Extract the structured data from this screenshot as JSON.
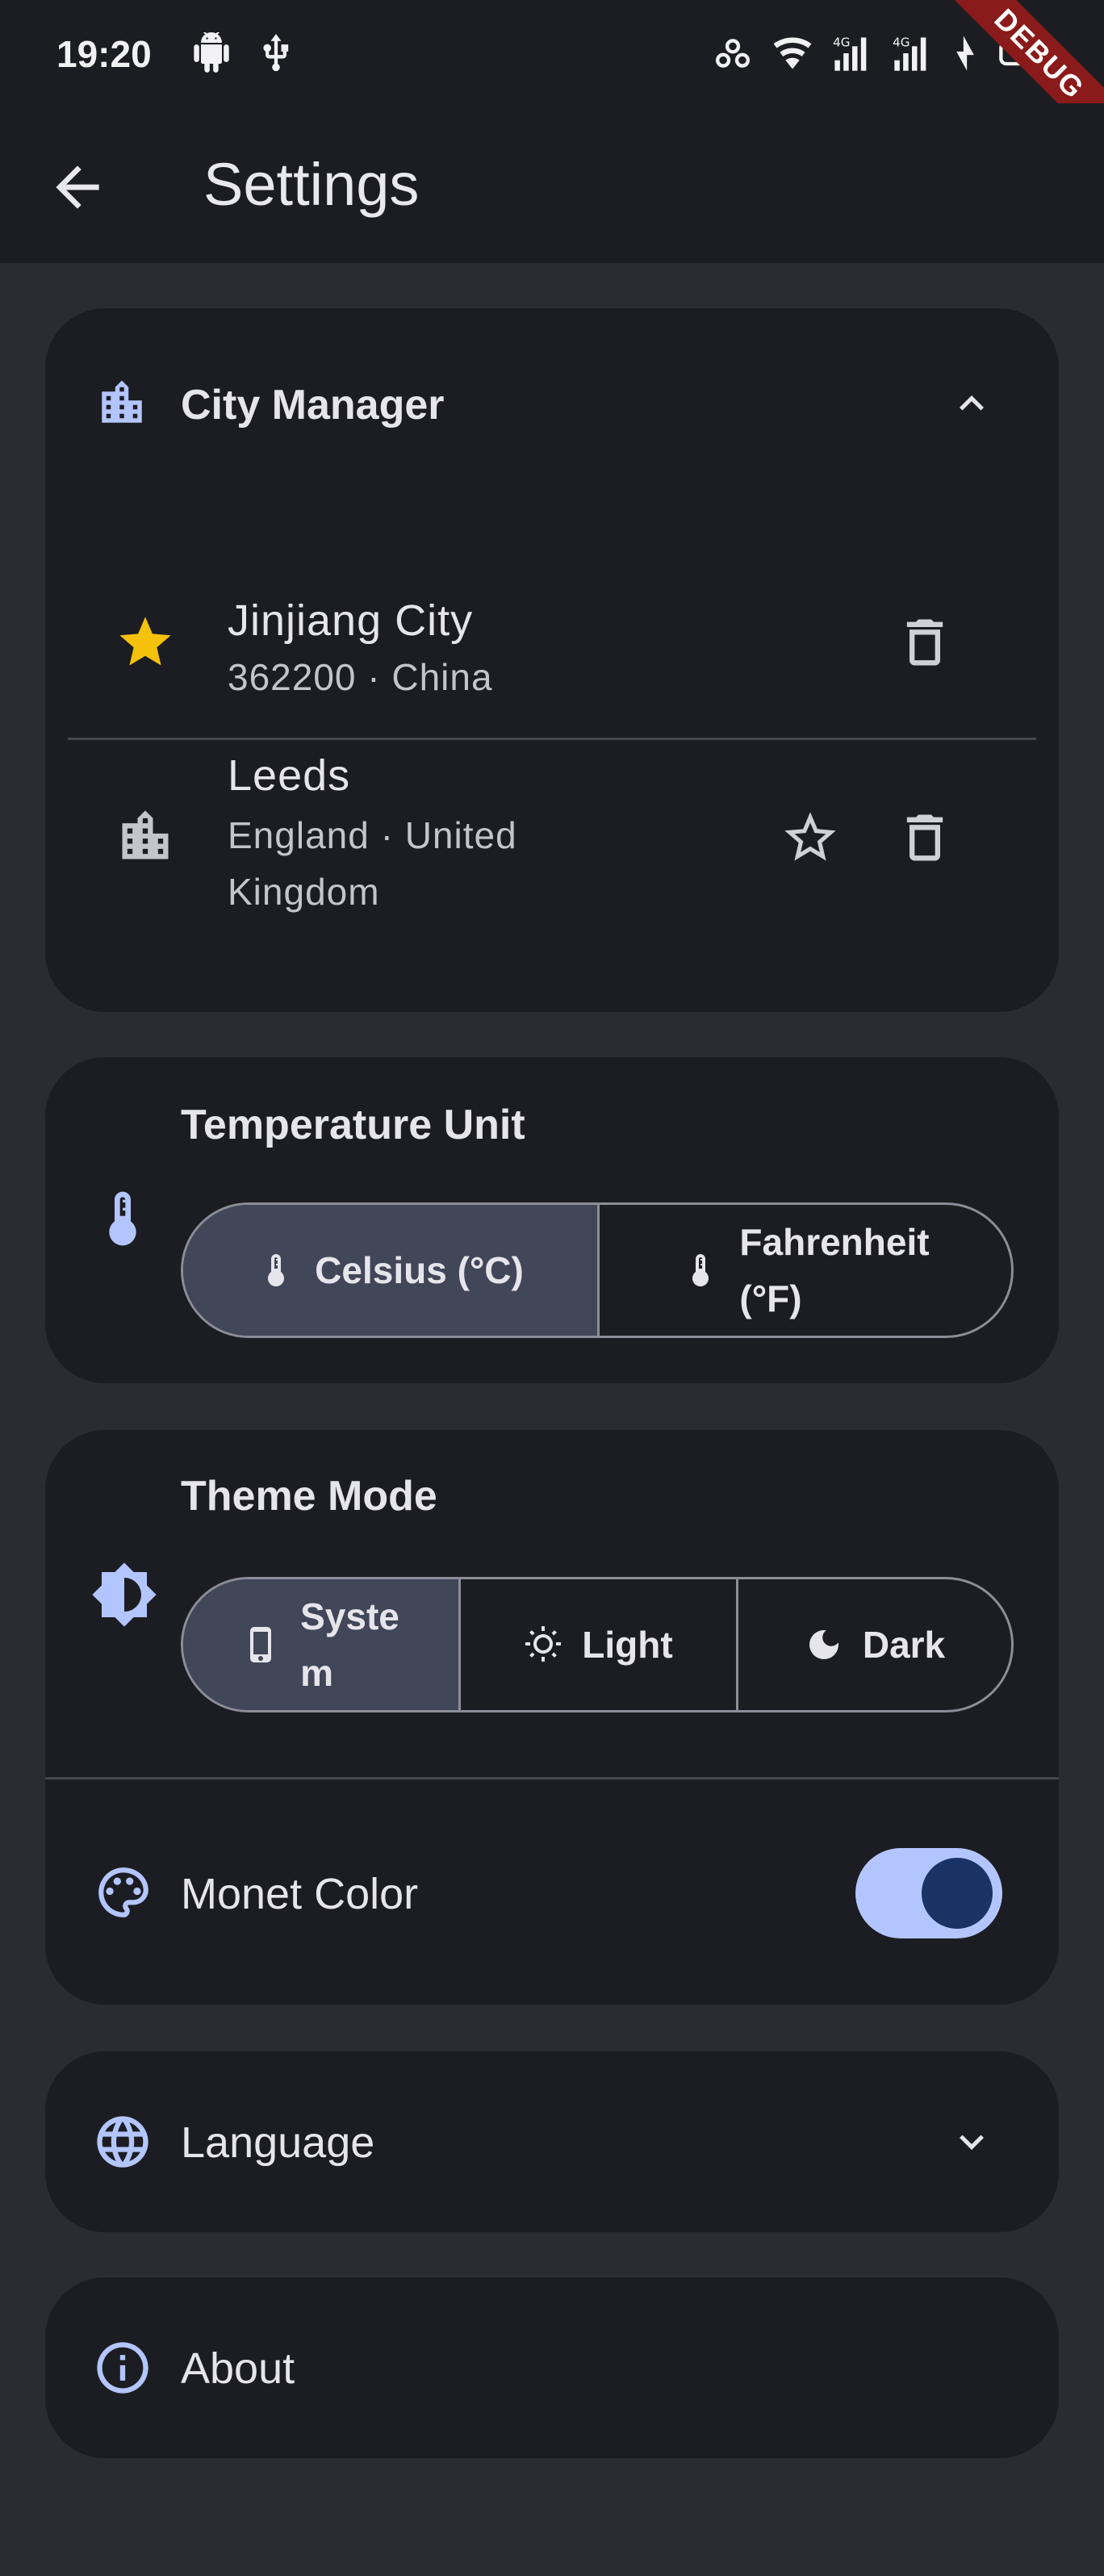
{
  "status_bar": {
    "time": "19:20",
    "left_icons": [
      "android-icon",
      "usb-icon"
    ],
    "right_icons": [
      "hotspot-icon",
      "wifi-icon",
      "signal-4g-icon",
      "signal-4g-icon",
      "charging-icon",
      "battery-icon"
    ],
    "debug_label": "DEBUG"
  },
  "app_bar": {
    "back_icon": "arrow-back-icon",
    "title": "Settings"
  },
  "city_manager": {
    "title": "City Manager",
    "icon": "city-icon",
    "expanded": true,
    "cities": [
      {
        "name": "Jinjiang City",
        "subtitle": "362200 · China",
        "favorite": true
      },
      {
        "name": "Leeds",
        "subtitle_line1": "England · United",
        "subtitle_line2": "Kingdom",
        "favorite": false
      }
    ]
  },
  "temperature_unit": {
    "title": "Temperature Unit",
    "icon": "thermometer-icon",
    "options": [
      {
        "label": "Celsius (°C)",
        "selected": true
      },
      {
        "label_line1": "Fahrenheit",
        "label_line2": "(°F)",
        "selected": false
      }
    ]
  },
  "theme_mode": {
    "title": "Theme Mode",
    "icon": "brightness-icon",
    "options": [
      {
        "label_line1": "Syste",
        "label_line2": "m",
        "icon": "phone-icon",
        "selected": true
      },
      {
        "label": "Light",
        "icon": "sun-icon",
        "selected": false
      },
      {
        "label": "Dark",
        "icon": "moon-icon",
        "selected": false
      }
    ]
  },
  "monet_color": {
    "title": "Monet Color",
    "icon": "palette-icon",
    "enabled": true
  },
  "language": {
    "title": "Language",
    "icon": "globe-icon",
    "expanded": false
  },
  "about": {
    "title": "About",
    "icon": "info-icon"
  },
  "colors": {
    "background": "#2b2c31",
    "surface": "#1c1d22",
    "accent": "#b3c5ff",
    "star": "#f5c20b",
    "selected_segment": "#424659",
    "outline": "#8b8d97"
  }
}
